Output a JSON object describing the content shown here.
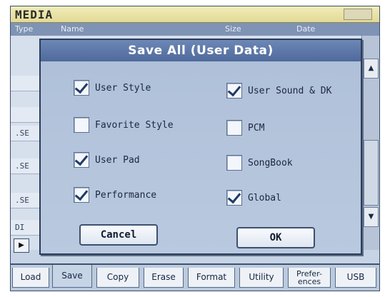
{
  "window": {
    "title": "MEDIA"
  },
  "header": {
    "col_type": "Type",
    "col_name": "Name",
    "col_size": "Size",
    "col_date": "Date"
  },
  "file_rows": [
    ".SE",
    ".SE",
    ".SE",
    "DI"
  ],
  "dialog": {
    "title": "Save All (User Data)",
    "options_left": [
      {
        "label": "User Style",
        "checked": true
      },
      {
        "label": "Favorite Style",
        "checked": false
      },
      {
        "label": "User Pad",
        "checked": true
      },
      {
        "label": "Performance",
        "checked": true
      }
    ],
    "options_right": [
      {
        "label": "User Sound & DK",
        "checked": true
      },
      {
        "label": "PCM",
        "checked": false
      },
      {
        "label": "SongBook",
        "checked": false
      },
      {
        "label": "Global",
        "checked": true
      }
    ],
    "cancel_label": "Cancel",
    "ok_label": "OK"
  },
  "tabs": [
    {
      "label": "Load",
      "active": false
    },
    {
      "label": "Save",
      "active": true
    },
    {
      "label": "Copy",
      "active": false
    },
    {
      "label": "Erase",
      "active": false
    },
    {
      "label": "Format",
      "active": false
    },
    {
      "label": "Utility",
      "active": false
    },
    {
      "label": "Prefer-\nences",
      "active": false
    },
    {
      "label": "USB",
      "active": false
    }
  ],
  "colors": {
    "dialog_title_bg": "#5a76a8",
    "screen_bg": "#c6d4e6",
    "title_bar_bg": "#e9e3a8"
  }
}
